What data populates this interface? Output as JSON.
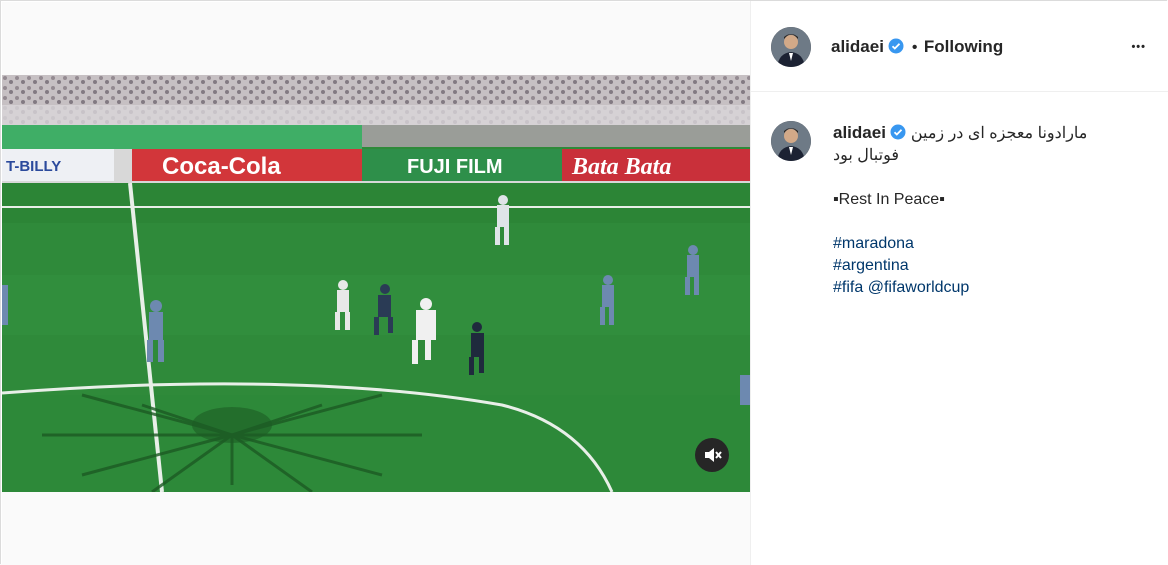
{
  "post": {
    "username": "alidaei",
    "separator": "•",
    "follow_status": "Following",
    "more_label": "•••",
    "caption": {
      "author": "alidaei",
      "text_line1": "مارادونا معجزه ای در زمین",
      "text_line2": "فوتبال بود",
      "rest_line": "▪Rest In Peace▪",
      "hashtags": [
        "#maradona",
        "#argentina",
        "#fifa"
      ],
      "mention": "@fifaworldcup"
    }
  },
  "video": {
    "ad_boards": [
      "T-BILLY",
      "Coca-Cola",
      "FUJI FILM",
      "Bata Bata"
    ],
    "muted": true
  },
  "colors": {
    "link": "#00376b",
    "verified": "#3897f0",
    "pitch": "#2f8a3a"
  },
  "icons": {
    "verified": "verified-badge-icon",
    "mute": "speaker-muted-icon",
    "more": "more-options-icon"
  }
}
